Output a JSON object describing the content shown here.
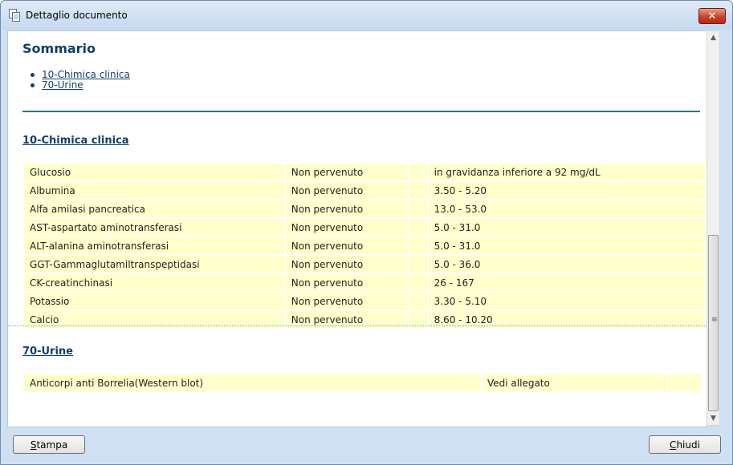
{
  "window": {
    "title": "Dettaglio documento",
    "close_glyph": "✕"
  },
  "summary": {
    "heading": "Sommario",
    "links": [
      {
        "label": "10-Chimica clinica"
      },
      {
        "label": "70-Urine"
      }
    ]
  },
  "sections": [
    {
      "title": "10-Chimica clinica",
      "rows": [
        {
          "name": "Glucosio",
          "result": "Non pervenuto",
          "flag": "",
          "range": "in gravidanza inferiore a 92 mg/dL"
        },
        {
          "name": "Albumina",
          "result": "Non pervenuto",
          "flag": "",
          "range": "3.50 - 5.20"
        },
        {
          "name": "Alfa amilasi pancreatica",
          "result": "Non pervenuto",
          "flag": "",
          "range": "13.0 - 53.0"
        },
        {
          "name": "AST-aspartato aminotransferasi",
          "result": "Non pervenuto",
          "flag": "",
          "range": "5.0 - 31.0"
        },
        {
          "name": "ALT-alanina aminotransferasi",
          "result": "Non pervenuto",
          "flag": "",
          "range": "5.0 - 31.0"
        },
        {
          "name": "GGT-Gammaglutamiltranspeptidasi",
          "result": "Non pervenuto",
          "flag": "",
          "range": "5.0 - 36.0"
        },
        {
          "name": "CK-creatinchinasi",
          "result": "Non pervenuto",
          "flag": "",
          "range": "26 - 167"
        },
        {
          "name": "Potassio",
          "result": "Non pervenuto",
          "flag": "",
          "range": "3.30 - 5.10"
        },
        {
          "name": "Calcio",
          "result": "Non pervenuto",
          "flag": "",
          "range": "8.60 - 10.20"
        }
      ]
    },
    {
      "title": "70-Urine",
      "rows": [
        {
          "name": "Anticorpi anti Borrelia(Western blot)",
          "result": "Vedi allegato",
          "flag": ""
        }
      ]
    }
  ],
  "buttons": {
    "print": {
      "mnemonic": "S",
      "rest": "tampa"
    },
    "close": {
      "mnemonic": "C",
      "rest": "hiudi"
    }
  },
  "icons": {
    "title": "document-copy-icon",
    "scroll_up": "scroll-up-arrow-icon",
    "scroll_down": "scroll-down-arrow-icon"
  },
  "colors": {
    "heading": "#0f3f6e",
    "separator": "#1f7b7b",
    "row_background": "#ffffcc"
  }
}
